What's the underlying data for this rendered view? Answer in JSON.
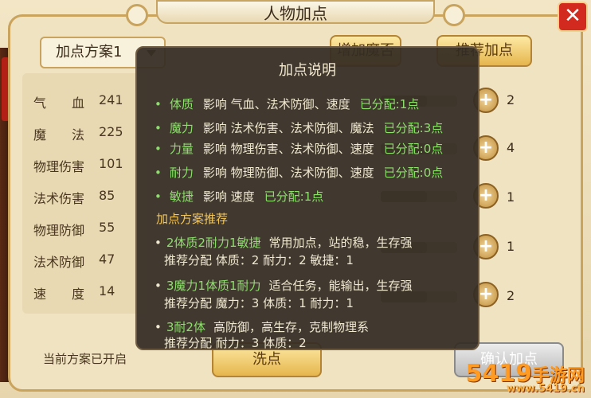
{
  "window": {
    "title": "人物加点",
    "close_label": "✕"
  },
  "plan_select": {
    "label": "加点方案1"
  },
  "stats": [
    {
      "name": "气　　血",
      "value": "241"
    },
    {
      "name": "魔　　法",
      "value": "225"
    },
    {
      "name": "物理伤害",
      "value": "101"
    },
    {
      "name": "法术伤害",
      "value": "85"
    },
    {
      "name": "物理防御",
      "value": "55"
    },
    {
      "name": "法术防御",
      "value": "47"
    },
    {
      "name": "速　　度",
      "value": "14"
    }
  ],
  "attribute_counts": [
    "2",
    "4",
    "1",
    "1",
    "2"
  ],
  "status_text": "当前方案已开启",
  "buttons": {
    "recommend_label": "推荐加点",
    "add_magic_label": "增加魔否",
    "wash_label": "洗点",
    "confirm_label": "确认加点",
    "plus_label": "+"
  },
  "help": {
    "title": "加点说明",
    "rules": [
      {
        "attr": "体质",
        "text": "影响 气血、法术防御、速度",
        "alloc": "已分配:1点"
      },
      {
        "attr": "魔力",
        "text": "影响 法术伤害、法术防御、魔法",
        "alloc": "已分配:3点"
      },
      {
        "attr": "力量",
        "text": "影响 物理伤害、法术防御、速度",
        "alloc": "已分配:0点"
      },
      {
        "attr": "耐力",
        "text": "影响 物理防御、法术防御、速度",
        "alloc": "已分配:0点"
      },
      {
        "attr": "敏捷",
        "text": "影响 速度",
        "alloc": "已分配:1点"
      }
    ],
    "rec_title": "加点方案推荐",
    "recommendations": [
      {
        "combo": "2体质2耐力1敏捷",
        "desc": "常用加点，站的稳，生存强",
        "detail": "推荐分配 体质：2 耐力：2 敏捷：1"
      },
      {
        "combo": "3魔力1体质1耐力",
        "desc": "适合任务，能输出，生存强",
        "detail": "推荐分配 魔力：3 体质：1 耐力：1"
      },
      {
        "combo": "3耐2体",
        "desc": "高防御，高生存，克制物理系",
        "detail": "推荐分配 耐力：3 体质：2"
      }
    ]
  },
  "watermark": {
    "brand": "5419",
    "suffix": "手游网",
    "domain": "www.5419.cn"
  },
  "colors": {
    "accent_green": "#8be06a",
    "heading_gold": "#f2c55a",
    "close_red": "#d22a1f"
  }
}
